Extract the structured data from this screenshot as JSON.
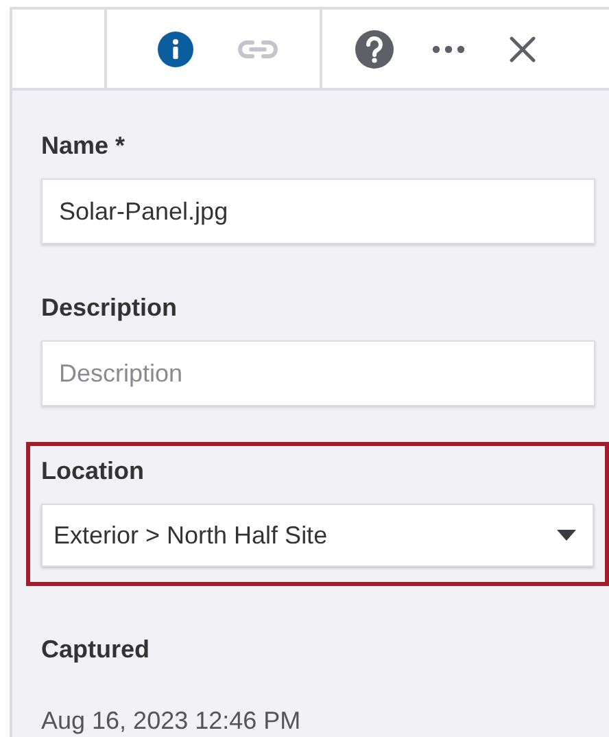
{
  "toolbar": {
    "tabs": [
      {
        "kind": "info",
        "selected": true
      },
      {
        "kind": "link",
        "selected": false
      }
    ],
    "actions": [
      {
        "kind": "help"
      },
      {
        "kind": "more"
      },
      {
        "kind": "close"
      }
    ]
  },
  "fields": [
    {
      "kind": "text",
      "label": "Name *",
      "value": "Solar-Panel.jpg",
      "highlighted": false
    },
    {
      "kind": "text",
      "label": "Description",
      "placeholder": "Description",
      "highlighted": false
    },
    {
      "kind": "select",
      "label": "Location",
      "value": "Exterior > North Half Site",
      "highlighted": true
    },
    {
      "kind": "readonly",
      "label": "Captured",
      "value": "Aug 16, 2023 12:46 PM",
      "highlighted": false
    }
  ]
}
